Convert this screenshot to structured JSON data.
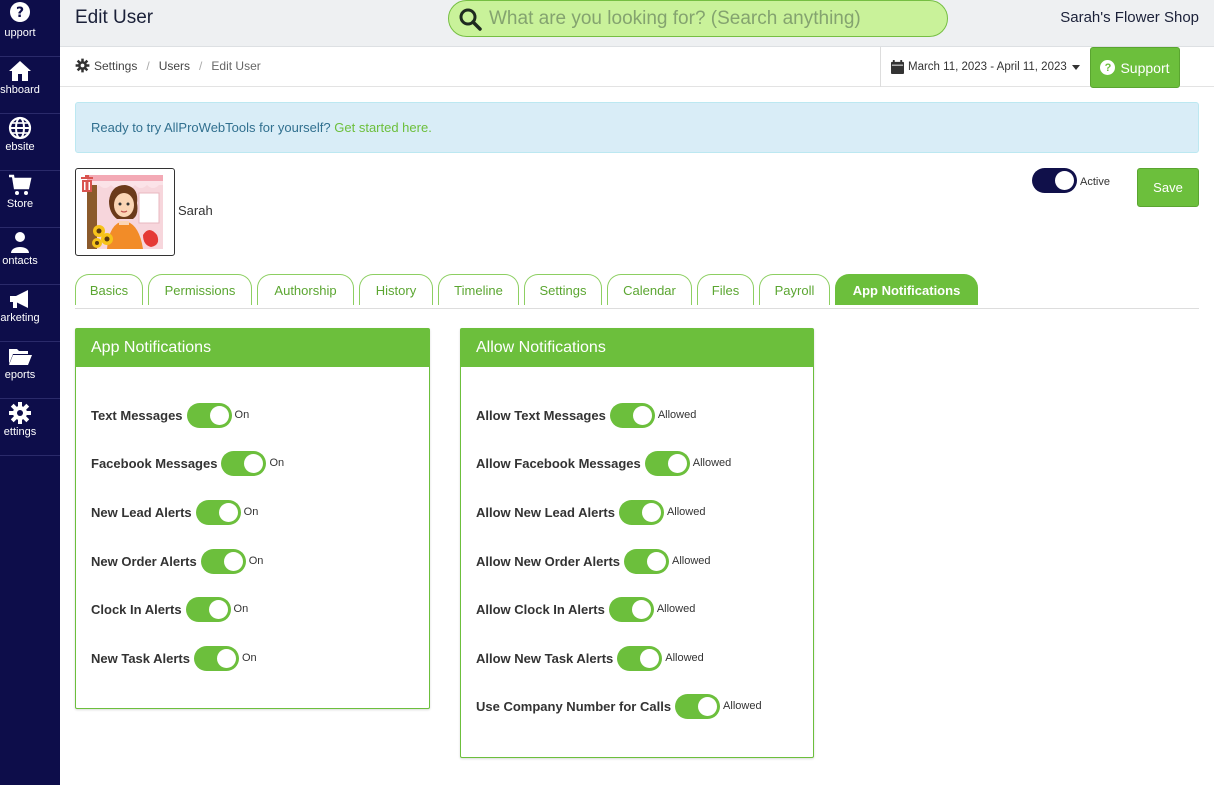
{
  "sidebar": {
    "items": [
      {
        "label": "upport",
        "icon": "question-circle-icon"
      },
      {
        "label": "shboard",
        "icon": "home-icon"
      },
      {
        "label": "ebsite",
        "icon": "globe-icon"
      },
      {
        "label": "Store",
        "icon": "cart-icon"
      },
      {
        "label": "ontacts",
        "icon": "user-icon"
      },
      {
        "label": "arketing",
        "icon": "megaphone-icon"
      },
      {
        "label": "eports",
        "icon": "folder-icon"
      },
      {
        "label": "ettings",
        "icon": "gear-icon"
      }
    ]
  },
  "header": {
    "title": "Edit User",
    "search_placeholder": "What are you looking for? (Search anything)",
    "shop_name": "Sarah's Flower Shop"
  },
  "breadcrumb": {
    "settings": "Settings",
    "users": "Users",
    "current": "Edit User",
    "separator": "/"
  },
  "date_range": "March 11, 2023 - April 11, 2023",
  "support_label": "Support",
  "alert": {
    "text": "Ready to try AllProWebTools for yourself? ",
    "link": "Get started here."
  },
  "user": {
    "name": "Sarah",
    "active_label": "Active",
    "active": true
  },
  "save_label": "Save",
  "tabs": [
    {
      "label": "Basics"
    },
    {
      "label": "Permissions"
    },
    {
      "label": "Authorship"
    },
    {
      "label": "History"
    },
    {
      "label": "Timeline"
    },
    {
      "label": "Settings"
    },
    {
      "label": "Calendar"
    },
    {
      "label": "Files"
    },
    {
      "label": "Payroll"
    },
    {
      "label": "App Notifications",
      "active": true
    }
  ],
  "app_notifications": {
    "title": "App Notifications",
    "items": [
      {
        "label": "Text Messages",
        "state": "On"
      },
      {
        "label": "Facebook Messages",
        "state": "On"
      },
      {
        "label": "New Lead Alerts",
        "state": "On"
      },
      {
        "label": "New Order Alerts",
        "state": "On"
      },
      {
        "label": "Clock In Alerts",
        "state": "On"
      },
      {
        "label": "New Task Alerts",
        "state": "On"
      }
    ]
  },
  "allow_notifications": {
    "title": "Allow Notifications",
    "items": [
      {
        "label": "Allow Text Messages",
        "state": "Allowed"
      },
      {
        "label": "Allow Facebook Messages",
        "state": "Allowed"
      },
      {
        "label": "Allow New Lead Alerts",
        "state": "Allowed"
      },
      {
        "label": "Allow New Order Alerts",
        "state": "Allowed"
      },
      {
        "label": "Allow Clock In Alerts",
        "state": "Allowed"
      },
      {
        "label": "Allow New Task Alerts",
        "state": "Allowed"
      },
      {
        "label": "Use Company Number for Calls",
        "state": "Allowed"
      }
    ]
  },
  "colors": {
    "sidebar": "#0d0d4a",
    "accent": "#6cbf3c",
    "search_bg": "#c9f29a",
    "alert_bg": "#d9edf7"
  }
}
